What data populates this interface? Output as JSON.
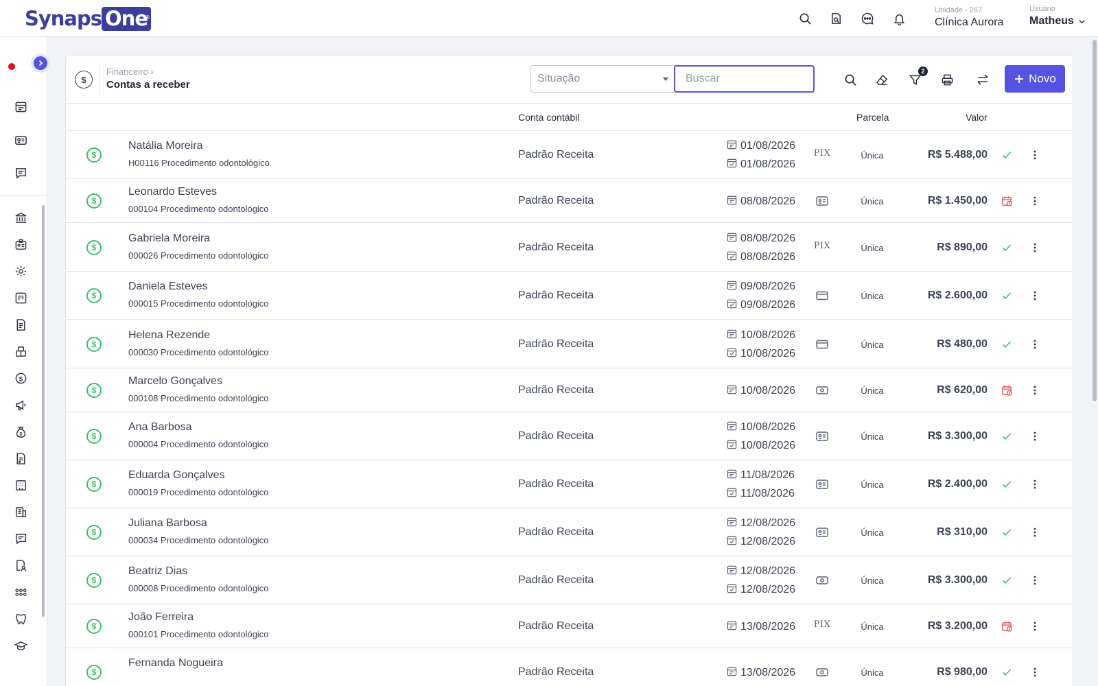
{
  "app": {
    "logo_left": "Synaps",
    "logo_right": "One",
    "logo_reg": "®"
  },
  "topbar": {
    "icons": [
      "search-icon",
      "document-search-icon",
      "chat-icon",
      "bell-icon"
    ],
    "unit_label": "Unidade - 267",
    "unit_name": "Clínica Aurora",
    "user_label": "Usuário",
    "user_name": "Matheus"
  },
  "page": {
    "breadcrumb": "Financeiro ›",
    "title": "Contas a receber",
    "situacao_placeholder": "Situação",
    "search_placeholder": "Buscar",
    "filter_count": "2",
    "new_button": "Novo"
  },
  "table": {
    "headers": {
      "account": "Conta contábil",
      "parcel": "Parcela",
      "value": "Valor"
    },
    "rows": [
      {
        "name": "Natália Moreira",
        "desc": "H00116 Procedimento odontológico",
        "account": "Padrão Receita",
        "date1": "01/08/2026",
        "date2": "01/08/2026",
        "pay": "pix",
        "parcel": "Única",
        "value": "R$ 5.488,00",
        "status": "paid"
      },
      {
        "name": "Leonardo Esteves",
        "desc": "000104 Procedimento odontológico",
        "account": "Padrão Receita",
        "date1": "08/08/2026",
        "date2": "",
        "pay": "boleto",
        "parcel": "Única",
        "value": "R$ 1.450,00",
        "status": "overdue"
      },
      {
        "name": "Gabriela Moreira",
        "desc": "000026 Procedimento odontológico",
        "account": "Padrão Receita",
        "date1": "08/08/2026",
        "date2": "08/08/2026",
        "pay": "pix",
        "parcel": "Única",
        "value": "R$ 890,00",
        "status": "paid"
      },
      {
        "name": "Daniela Esteves",
        "desc": "000015 Procedimento odontológico",
        "account": "Padrão Receita",
        "date1": "09/08/2026",
        "date2": "09/08/2026",
        "pay": "card",
        "parcel": "Única",
        "value": "R$ 2.600,00",
        "status": "paid"
      },
      {
        "name": "Helena Rezende",
        "desc": "000030 Procedimento odontológico",
        "account": "Padrão Receita",
        "date1": "10/08/2026",
        "date2": "10/08/2026",
        "pay": "card",
        "parcel": "Única",
        "value": "R$ 480,00",
        "status": "paid"
      },
      {
        "name": "Marcelo Gonçalves",
        "desc": "000108 Procedimento odontológico",
        "account": "Padrão Receita",
        "date1": "10/08/2026",
        "date2": "",
        "pay": "cash",
        "parcel": "Única",
        "value": "R$ 620,00",
        "status": "overdue"
      },
      {
        "name": "Ana Barbosa",
        "desc": "000004 Procedimento odontológico",
        "account": "Padrão Receita",
        "date1": "10/08/2026",
        "date2": "10/08/2026",
        "pay": "boleto",
        "parcel": "Única",
        "value": "R$ 3.300,00",
        "status": "paid"
      },
      {
        "name": "Eduarda Gonçalves",
        "desc": "000019 Procedimento odontológico",
        "account": "Padrão Receita",
        "date1": "11/08/2026",
        "date2": "11/08/2026",
        "pay": "boleto",
        "parcel": "Única",
        "value": "R$ 2.400,00",
        "status": "paid"
      },
      {
        "name": "Juliana Barbosa",
        "desc": "000034 Procedimento odontológico",
        "account": "Padrão Receita",
        "date1": "12/08/2026",
        "date2": "12/08/2026",
        "pay": "boleto",
        "parcel": "Única",
        "value": "R$ 310,00",
        "status": "paid"
      },
      {
        "name": "Beatriz Dias",
        "desc": "000008 Procedimento odontológico",
        "account": "Padrão Receita",
        "date1": "12/08/2026",
        "date2": "12/08/2026",
        "pay": "cash",
        "parcel": "Única",
        "value": "R$ 3.300,00",
        "status": "paid"
      },
      {
        "name": "João Ferreira",
        "desc": "000101 Procedimento odontológico",
        "account": "Padrão Receita",
        "date1": "13/08/2026",
        "date2": "",
        "pay": "pix",
        "parcel": "Única",
        "value": "R$ 3.200,00",
        "status": "overdue"
      },
      {
        "name": "Fernanda Nogueira",
        "desc": "",
        "account": "Padrão Receita",
        "date1": "13/08/2026",
        "date2": "",
        "pay": "cash",
        "parcel": "Única",
        "value": "R$ 980,00",
        "status": "paid"
      }
    ]
  },
  "colors": {
    "accent": "#5653e3",
    "paid": "#3ec06a",
    "overdue": "#e5484d",
    "logo": "#3b3f9c"
  }
}
